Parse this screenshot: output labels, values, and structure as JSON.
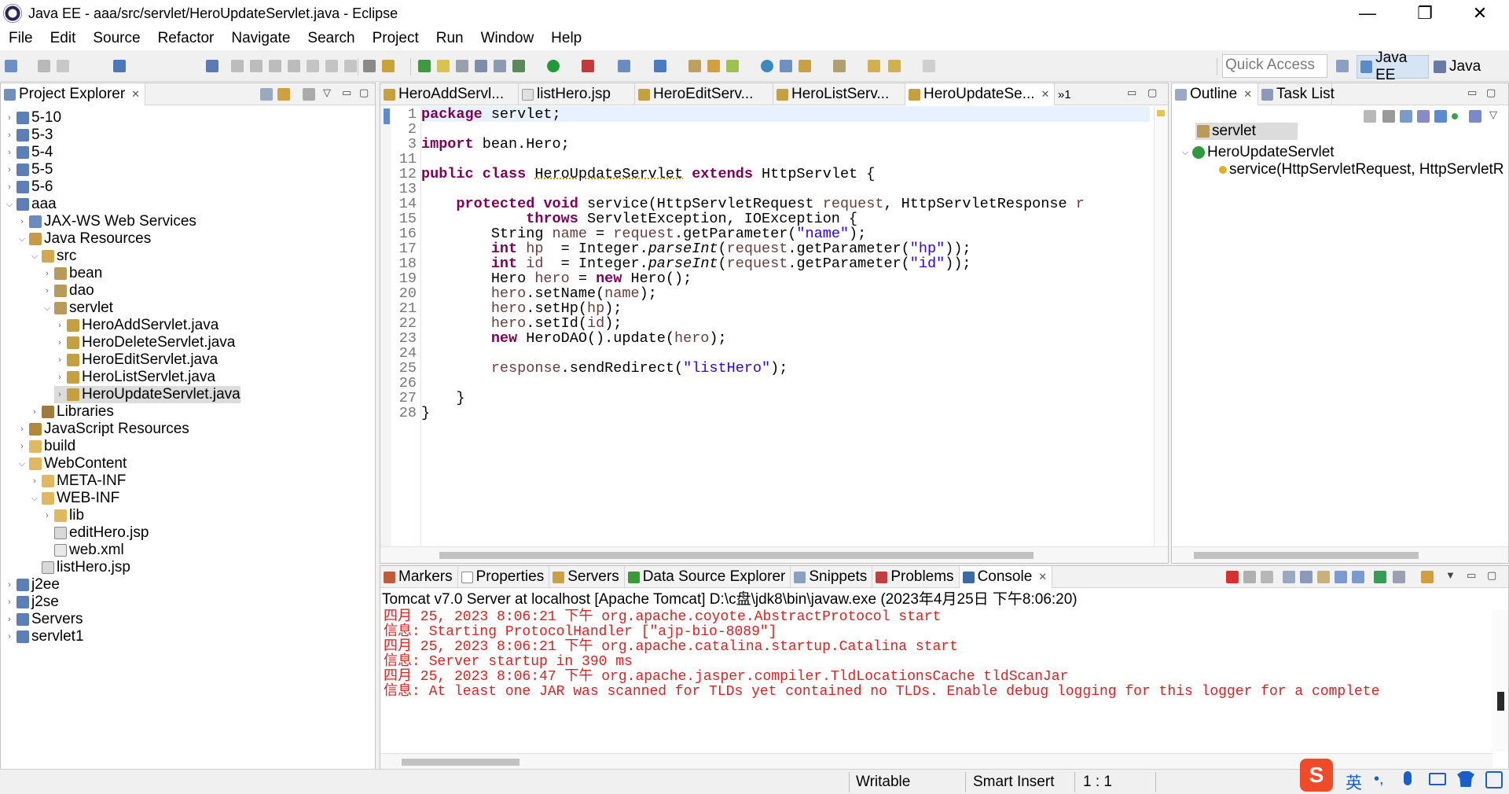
{
  "window": {
    "title": "Java EE - aaa/src/servlet/HeroUpdateServlet.java - Eclipse"
  },
  "menu": [
    "File",
    "Edit",
    "Source",
    "Refactor",
    "Navigate",
    "Search",
    "Project",
    "Run",
    "Window",
    "Help"
  ],
  "toolbar": {
    "quick_access": "Quick Access",
    "perspectives": [
      "Java EE",
      "Java"
    ]
  },
  "project_explorer": {
    "title": "Project Explorer",
    "tree": [
      {
        "label": "5-10",
        "icon": "project-icon"
      },
      {
        "label": "5-3",
        "icon": "project-icon"
      },
      {
        "label": "5-4",
        "icon": "project-icon"
      },
      {
        "label": "5-5",
        "icon": "project-icon"
      },
      {
        "label": "5-6",
        "icon": "project-icon"
      },
      {
        "label": "aaa",
        "icon": "project-icon"
      },
      {
        "label": "JAX-WS Web Services",
        "icon": "webservice-icon"
      },
      {
        "label": "Java Resources",
        "icon": "java-resources-icon"
      },
      {
        "label": "src",
        "icon": "source-folder-icon"
      },
      {
        "label": "bean",
        "icon": "package-icon"
      },
      {
        "label": "dao",
        "icon": "package-icon"
      },
      {
        "label": "servlet",
        "icon": "package-icon"
      },
      {
        "label": "HeroAddServlet.java",
        "icon": "java-file-icon"
      },
      {
        "label": "HeroDeleteServlet.java",
        "icon": "java-file-icon"
      },
      {
        "label": "HeroEditServlet.java",
        "icon": "java-file-icon"
      },
      {
        "label": "HeroListServlet.java",
        "icon": "java-file-icon"
      },
      {
        "label": "HeroUpdateServlet.java",
        "icon": "java-file-icon"
      },
      {
        "label": "Libraries",
        "icon": "libraries-icon"
      },
      {
        "label": "JavaScript Resources",
        "icon": "js-resources-icon"
      },
      {
        "label": "build",
        "icon": "folder-icon"
      },
      {
        "label": "WebContent",
        "icon": "folder-icon"
      },
      {
        "label": "META-INF",
        "icon": "folder-icon"
      },
      {
        "label": "WEB-INF",
        "icon": "folder-icon"
      },
      {
        "label": "lib",
        "icon": "folder-icon"
      },
      {
        "label": "editHero.jsp",
        "icon": "jsp-file-icon"
      },
      {
        "label": "web.xml",
        "icon": "xml-file-icon"
      },
      {
        "label": "listHero.jsp",
        "icon": "jsp-file-icon"
      },
      {
        "label": "j2ee",
        "icon": "project-icon"
      },
      {
        "label": "j2se",
        "icon": "project-icon"
      },
      {
        "label": "Servers",
        "icon": "servers-folder-icon"
      },
      {
        "label": "servlet1",
        "icon": "project-icon"
      }
    ]
  },
  "editor": {
    "tabs": [
      "HeroAddServl...",
      "listHero.jsp",
      "HeroEditServ...",
      "HeroListServ...",
      "HeroUpdateSe..."
    ],
    "overflow": "»1",
    "line_numbers": [
      "1",
      "2",
      "3",
      "11",
      "12",
      "13",
      "14",
      "15",
      "16",
      "17",
      "18",
      "19",
      "20",
      "21",
      "22",
      "23",
      "24",
      "25",
      "26",
      "27",
      "28"
    ]
  },
  "outline": {
    "tabs": [
      "Outline",
      "Task List"
    ],
    "items": [
      "servlet",
      "HeroUpdateServlet",
      "service(HttpServletRequest, HttpServletR"
    ]
  },
  "bottom": {
    "tabs": [
      "Markers",
      "Properties",
      "Servers",
      "Data Source Explorer",
      "Snippets",
      "Problems",
      "Console"
    ],
    "console_header": "Tomcat v7.0 Server at localhost [Apache Tomcat] D:\\c盘\\jdk8\\bin\\javaw.exe (2023年4月25日 下午8:06:20)",
    "console_lines": [
      "四月 25, 2023 8:06:21 下午 org.apache.coyote.AbstractProtocol start",
      "信息: Starting ProtocolHandler [\"ajp-bio-8089\"]",
      "四月 25, 2023 8:06:21 下午 org.apache.catalina.startup.Catalina start",
      "信息: Server startup in 390 ms",
      "四月 25, 2023 8:06:47 下午 org.apache.jasper.compiler.TldLocationsCache tldScanJar",
      "信息: At least one JAR was scanned for TLDs yet contained no TLDs. Enable debug logging for this logger for a complete"
    ]
  },
  "statusbar": {
    "writable": "Writable",
    "insert_mode": "Smart Insert",
    "position": "1 : 1"
  },
  "ime": {
    "lang": "英"
  },
  "colors": {
    "keyword": "#7f0055",
    "string": "#2a00ff",
    "variable": "#6a3e3e",
    "console_error": "#e02020"
  }
}
